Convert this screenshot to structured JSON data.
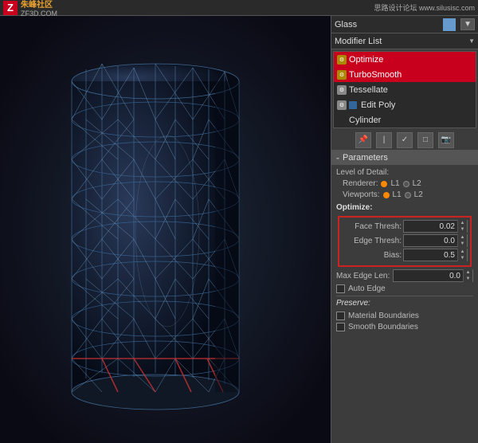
{
  "topbar": {
    "logo_letter": "Z",
    "logo_main": "朱峰社区",
    "logo_sub": "ZF3D.COM",
    "site_info": "思路设计论坛 www.silusisc.com"
  },
  "rightpanel": {
    "material_name": "Glass",
    "modifier_list_label": "Modifier List",
    "modifiers": [
      {
        "id": "optimize",
        "name": "Optimize",
        "icon_type": "yellow",
        "selected": true
      },
      {
        "id": "turbosmooth",
        "name": "TurboSmooth",
        "icon_type": "yellow",
        "selected": true
      },
      {
        "id": "tessellate",
        "name": "Tessellate",
        "icon_type": "gear",
        "selected": false
      },
      {
        "id": "editpoly",
        "name": "Edit Poly",
        "icon_type": "blue",
        "selected": false
      },
      {
        "id": "cylinder",
        "name": "Cylinder",
        "icon_type": "none",
        "selected": false
      }
    ],
    "toolbar_icons": [
      "pin",
      "bar",
      "check",
      "square",
      "camera"
    ],
    "parameters": {
      "section_title": "Parameters",
      "level_of_detail": "Level of Detail:",
      "renderer_label": "Renderer:",
      "renderer_options": [
        "L1",
        "L2"
      ],
      "renderer_active": "L1",
      "viewports_label": "Viewports:",
      "viewports_options": [
        "L1",
        "L2"
      ],
      "viewports_active": "L1",
      "optimize_label": "Optimize:",
      "face_thresh_label": "Face Thresh:",
      "face_thresh_value": "0.02",
      "edge_thresh_label": "Edge Thresh:",
      "edge_thresh_value": "0.0",
      "bias_label": "Bias:",
      "bias_value": "0.5",
      "max_edge_len_label": "Max Edge Len:",
      "max_edge_len_value": "0.0",
      "auto_edge_label": "Auto Edge",
      "preserve_label": "Preserve:",
      "material_boundaries_label": "Material Boundaries",
      "smooth_boundaries_label": "Smooth Boundaries"
    }
  }
}
